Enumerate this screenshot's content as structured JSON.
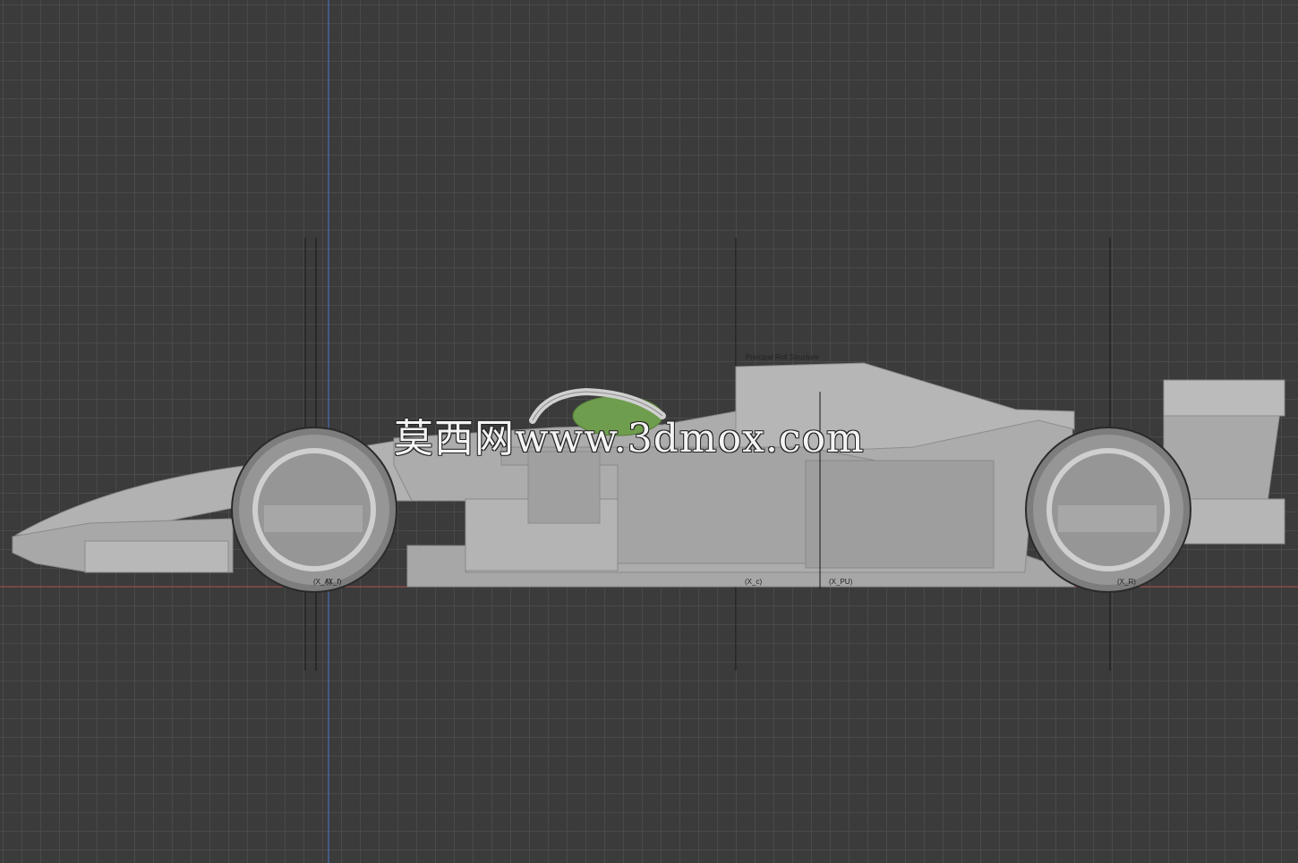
{
  "viewport": {
    "grid": "on",
    "colors": {
      "background": "#3b3b3b",
      "grid_minor": "#4a4a4a",
      "grid_major": "#303030",
      "axis_y": "#4a6fb5",
      "axis_x": "#a84a4a",
      "body": "#a9a9a9",
      "halo": "#c8c8c8",
      "cockpit": "#6f9d4e"
    }
  },
  "annotations": {
    "principal_roll_structure": "Principal Roll Structure",
    "front_axle": "(X_f)",
    "front_axle_alt": "(X_A)",
    "cockpit_ref": "(X_c)",
    "power_unit_ref": "(X_PU)",
    "rear_axle": "(X_R)"
  },
  "watermark": {
    "text": "莫西网www.3dmox.com"
  }
}
